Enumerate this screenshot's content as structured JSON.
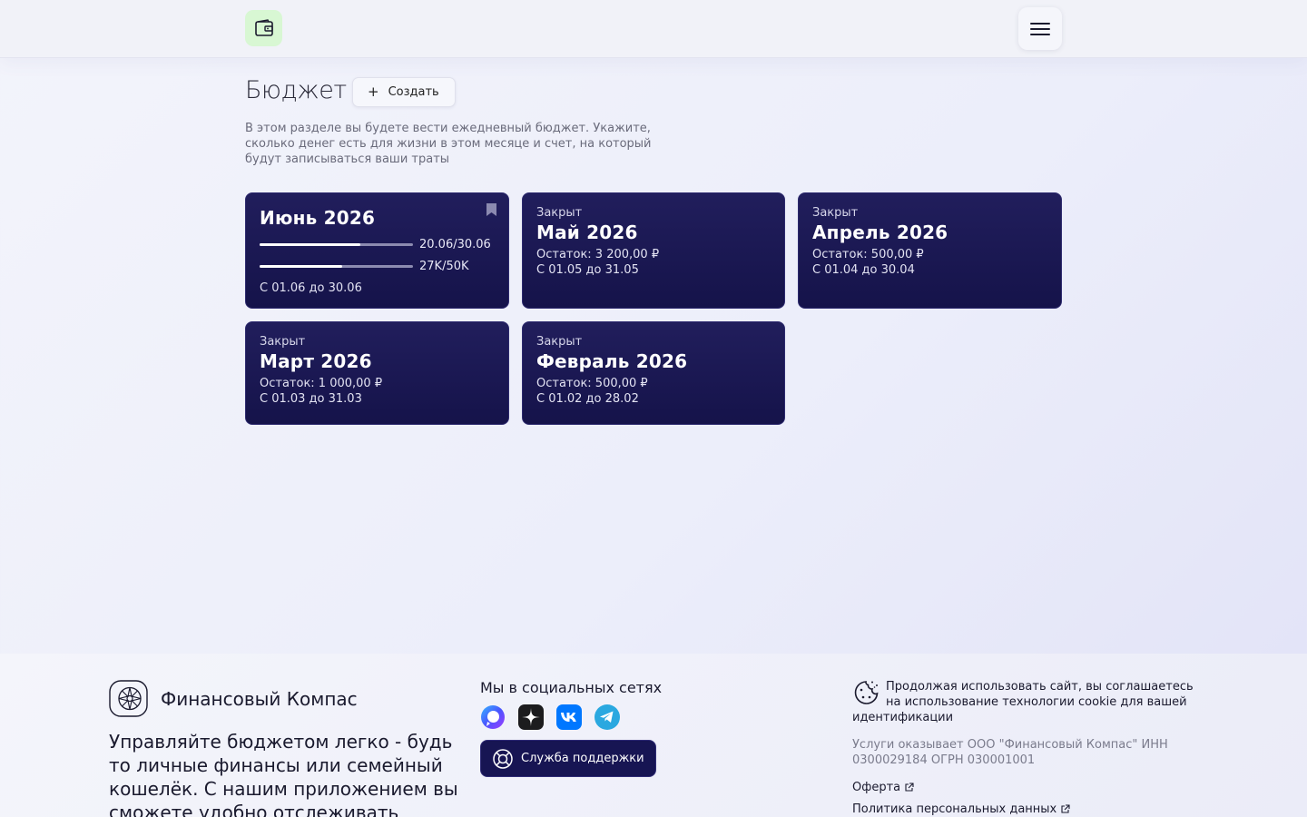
{
  "header": {
    "logo_icon": "wallet-icon",
    "menu_icon": "hamburger-icon"
  },
  "page": {
    "title": "Бюджет",
    "create_label": "Создать",
    "description": "В этом разделе вы будете вести ежедневный бюджет. Укажите, сколько денег есть для жизни в этом месяце и счет, на который будут записываться ваши траты"
  },
  "budgets": {
    "current": {
      "name": "Июнь 2026",
      "days_label": "20.06/30.06",
      "days_progress": 0.657,
      "money_label": "27K/50K",
      "money_progress": 0.54,
      "period": "С 01.06 до 30.06",
      "bookmark_icon": "bookmark-icon"
    },
    "closed": [
      {
        "status": "Закрыт",
        "name": "Май 2026",
        "balance": "Остаток: 3 200,00 ₽",
        "period": "С 01.05 до 31.05"
      },
      {
        "status": "Закрыт",
        "name": "Апрель 2026",
        "balance": "Остаток: 500,00 ₽",
        "period": "С 01.04 до 30.04"
      },
      {
        "status": "Закрыт",
        "name": "Март 2026",
        "balance": "Остаток: 1 000,00 ₽",
        "period": "С 01.03 до 31.03"
      },
      {
        "status": "Закрыт",
        "name": "Февраль 2026",
        "balance": "Остаток: 500,00 ₽",
        "period": "С 01.02 до 28.02"
      }
    ]
  },
  "footer": {
    "brand_name": "Финансовый Компас",
    "brand_text": "Управляйте бюджетом легко - будь то личные финансы или семейный кошелёк. С нашим приложением вы сможете удобно отслеживать",
    "social_title": "Мы в социальных сетях",
    "social_icons": [
      "max-icon",
      "dzen-icon",
      "vk-icon",
      "telegram-icon"
    ],
    "support_label": "Служба поддержки",
    "cookie_text": "Продолжая использовать сайт, вы соглашаетесь на использование технологии cookie для вашей идентификации",
    "legal_text": "Услуги оказывает ООО \"Финансовый Компас\" ИНН 0300029184 ОГРН 030001001",
    "offer_link": "Оферта",
    "privacy_link": "Политика персональных данных"
  }
}
